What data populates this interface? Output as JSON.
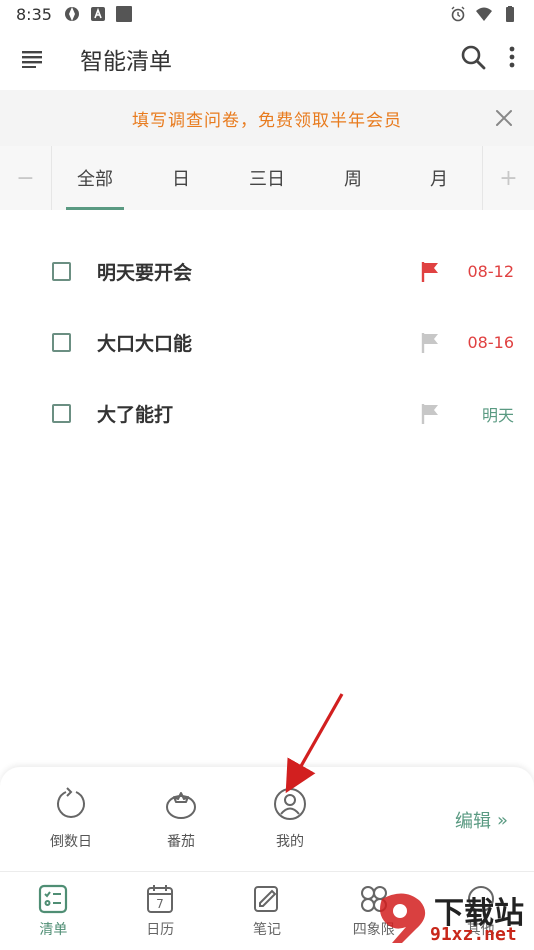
{
  "status_bar": {
    "time": "8:35"
  },
  "app_bar": {
    "title": "智能清单"
  },
  "banner": {
    "text": "填写调查问卷，免费领取半年会员"
  },
  "range_tabs": {
    "minus": "−",
    "plus": "+",
    "tabs": [
      {
        "label": "全部",
        "active": true
      },
      {
        "label": "日"
      },
      {
        "label": "三日"
      },
      {
        "label": "周"
      },
      {
        "label": "月"
      }
    ]
  },
  "tasks": [
    {
      "name": "明天要开会",
      "date": "08-12",
      "date_color": "#e04141",
      "flag_color": "#e04141"
    },
    {
      "name": "大口大口能",
      "date": "08-16",
      "date_color": "#e04141",
      "flag_color": "#c7c7c7"
    },
    {
      "name": "大了能打",
      "date": "明天",
      "date_color": "#5a9a82",
      "flag_color": "#c7c7c7"
    }
  ],
  "sheet": {
    "items": [
      {
        "label": "倒数日",
        "icon": "countdown-icon"
      },
      {
        "label": "番茄",
        "icon": "tomato-icon"
      },
      {
        "label": "我的",
        "icon": "profile-icon"
      }
    ],
    "edit_label": "编辑",
    "edit_chevrons": "»"
  },
  "bottom_nav": [
    {
      "label": "清单",
      "icon": "checklist-icon",
      "active": true
    },
    {
      "label": "日历",
      "icon": "calendar-icon",
      "calendar_day": "7"
    },
    {
      "label": "笔记",
      "icon": "note-icon"
    },
    {
      "label": "四象限",
      "icon": "quadrant-icon"
    },
    {
      "label": "其他",
      "icon": "more-icon"
    }
  ],
  "watermark": {
    "brand": "下载站",
    "domain": "91xz.net"
  },
  "colors": {
    "accent": "#5a9a82",
    "banner_text": "#e87b1e",
    "red": "#e04141"
  }
}
